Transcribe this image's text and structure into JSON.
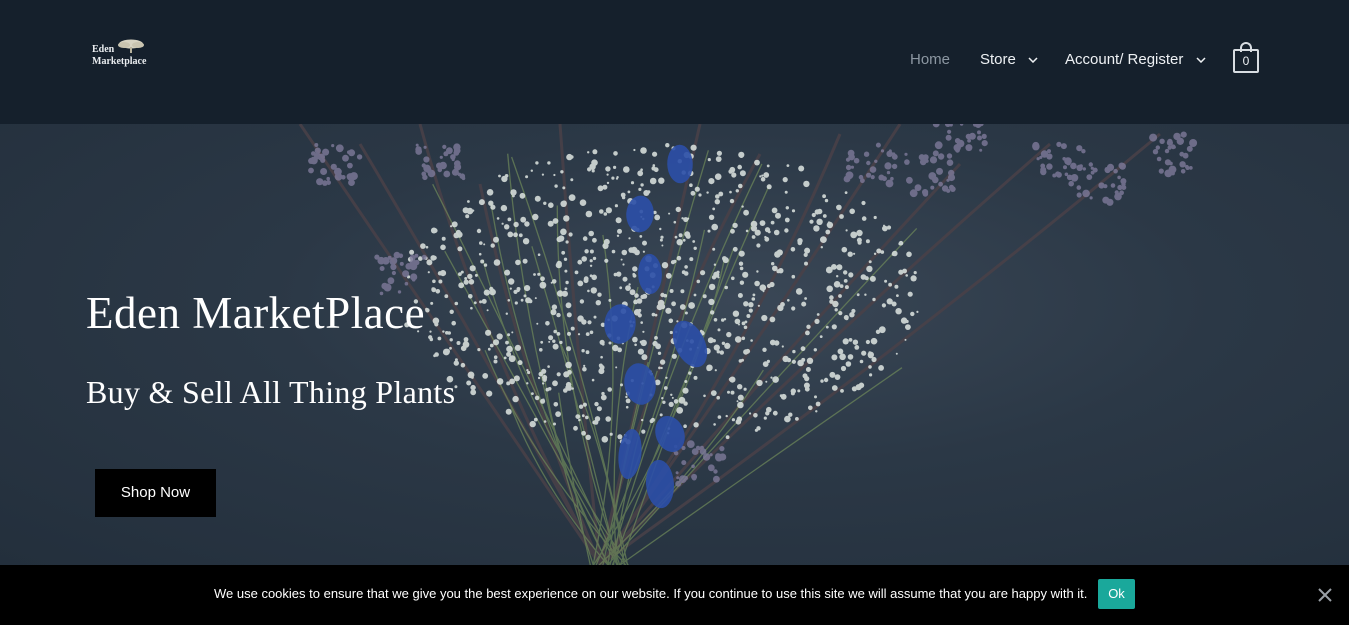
{
  "header": {
    "logo": {
      "line1": "Eden",
      "line2": "Marketplace"
    },
    "nav": {
      "home": "Home",
      "store": "Store",
      "account": "Account/ Register"
    },
    "cart": {
      "count": "0"
    }
  },
  "hero": {
    "title": "Eden MarketPlace",
    "subtitle": "Buy & Sell All Thing Plants",
    "cta": "Shop Now"
  },
  "cookie": {
    "message": "We use cookies to ensure that we give you the best experience on our website. If you continue to use this site we will assume that you are happy with it.",
    "ok": "Ok"
  },
  "icons": {
    "logo": "tree-logo-icon",
    "store_dropdown": "chevron-down-icon",
    "account_dropdown": "chevron-down-icon",
    "cart": "shopping-bag-icon",
    "close": "close-icon"
  },
  "colors": {
    "header_bg": "#15202c",
    "hero_bg": "#2b3846",
    "nav_active": "#8c97a2",
    "button_bg": "#000000",
    "cookie_ok": "#1aa89b",
    "flower_blue": "#2c4fa8"
  }
}
